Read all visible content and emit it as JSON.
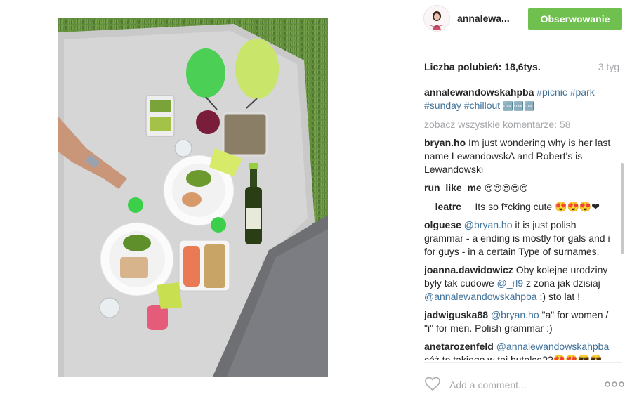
{
  "post": {
    "image_icon": "picnic-photo"
  },
  "header": {
    "username": "annalewa...",
    "follow_label": "Obserwowanie",
    "avatar_icon": "profile-avatar"
  },
  "likes": {
    "label": "Liczba polubień:",
    "count": "18,6tys.",
    "time_ago": "3 tyg."
  },
  "caption": {
    "user": "annalewandowskahpba",
    "tags": "#picnic #park #sunday #chillout",
    "emoji": "🆒🆒🆒"
  },
  "view_all": "zobacz wszystkie komentarze: 58",
  "comments": [
    {
      "user": "bryan.ho",
      "text": "Im just wondering why is her last name LewandowskA and Robert's is Lewandowski"
    },
    {
      "user": "run_like_me",
      "text": "😍😍😍😍😍"
    },
    {
      "user": "__leatrc__",
      "text": "Its so f*cking cute 😍😍😍❤"
    },
    {
      "user": "olguese",
      "mention": "@bryan.ho",
      "text": "it is just polish grammar - a ending is mostly for gals and i for guys - in a certain Type of surnames."
    },
    {
      "user": "joanna.dawidowicz",
      "text1": "Oby kolejne urodziny były tak cudowe",
      "mention1": "@_rl9",
      "text2": "z żona jak dzisiaj",
      "mention2": "@annalewandowskahpba",
      "text3": ":) sto lat !"
    },
    {
      "user": "jadwiguska88",
      "mention": "@bryan.ho",
      "text": "\"a\" for women / \"i\" for men. Polish grammar :)"
    },
    {
      "user": "anetarozenfeld",
      "mention": "@annalewandowskahpba",
      "text": "cóż to takiego w tej butelce??😍😍😎😎😎"
    }
  ],
  "footer": {
    "heart_icon": "heart-outline",
    "comment_placeholder": "Add a comment...",
    "more_icon": "more-horizontal"
  }
}
